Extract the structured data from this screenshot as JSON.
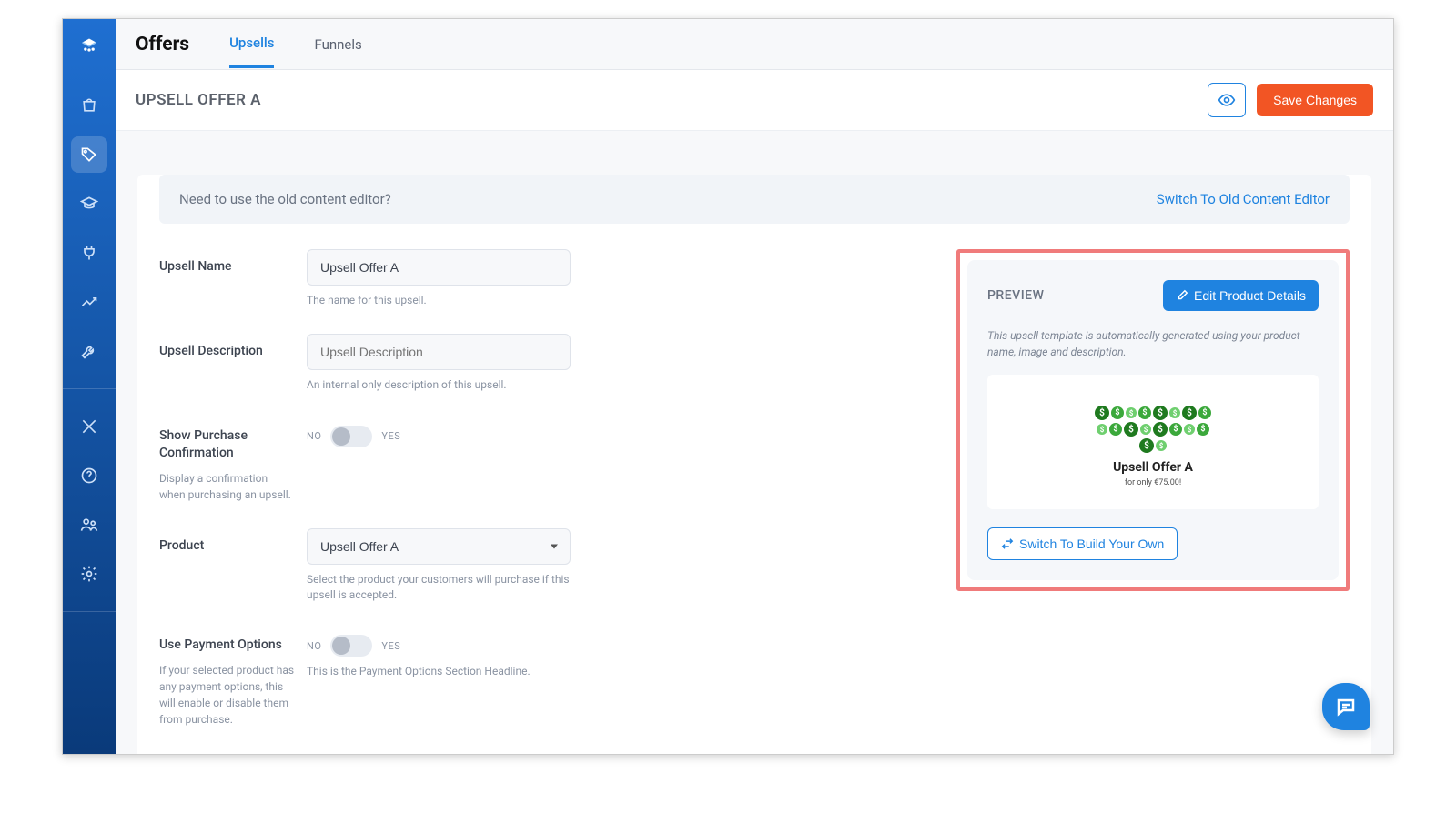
{
  "tabs": {
    "section": "Offers",
    "items": [
      "Upsells",
      "Funnels"
    ],
    "active": "Upsells"
  },
  "page": {
    "title": "UPSELL OFFER A",
    "save_button": "Save Changes"
  },
  "notice": {
    "question": "Need to use the old content editor?",
    "link": "Switch To Old Content Editor"
  },
  "form": {
    "upsell_name": {
      "label": "Upsell Name",
      "value": "Upsell Offer A",
      "help": "The name for this upsell."
    },
    "upsell_description": {
      "label": "Upsell Description",
      "placeholder": "Upsell Description",
      "help": "An internal only description of this upsell."
    },
    "show_confirmation": {
      "label": "Show Purchase Confirmation",
      "sub": "Display a confirmation when purchasing an upsell.",
      "no": "NO",
      "yes": "YES"
    },
    "product": {
      "label": "Product",
      "value": "Upsell Offer A",
      "help": "Select the product your customers will purchase if this upsell is accepted."
    },
    "payment_options": {
      "label": "Use Payment Options",
      "sub": "If your selected product has any payment options, this will enable or disable them from purchase.",
      "no": "NO",
      "yes": "YES",
      "help": "This is the Payment Options Section Headline."
    }
  },
  "preview": {
    "heading": "PREVIEW",
    "edit_button": "Edit Product Details",
    "description": "This upsell template is automatically generated using your product name, image and description.",
    "card_title": "Upsell Offer A",
    "card_sub": "for only €75.00!",
    "switch_button": "Switch To Build Your Own"
  }
}
